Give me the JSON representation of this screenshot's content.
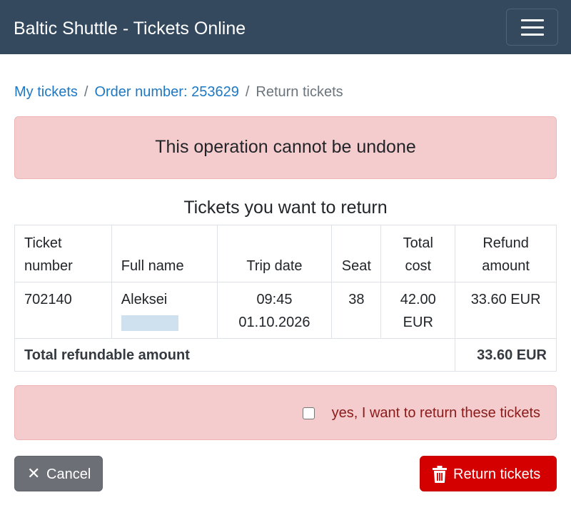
{
  "header": {
    "brand": "Baltic Shuttle - Tickets Online",
    "menu_icon": "hamburger-menu-icon"
  },
  "breadcrumb": {
    "items": [
      "My tickets",
      "Order number: 253629",
      "Return tickets"
    ],
    "separator": "/"
  },
  "alert": {
    "text": "This operation cannot be undone"
  },
  "section": {
    "title": "Tickets you want to return"
  },
  "table": {
    "headers": {
      "ticket_number": "Ticket number",
      "full_name": "Full name",
      "trip_date": "Trip date",
      "seat": "Seat",
      "total_cost": "Total cost",
      "refund_amount": "Refund amount"
    },
    "rows": [
      {
        "ticket_number": "702140",
        "full_name": "Aleksei",
        "trip_time": "09:45",
        "trip_date": "01.10.2026",
        "seat": "38",
        "total_cost": "42.00 EUR",
        "refund_amount": "33.60 EUR"
      }
    ],
    "footer": {
      "label": "Total refundable amount",
      "value": "33.60 EUR"
    }
  },
  "confirm": {
    "label": "yes, I want to return these tickets",
    "checked": false
  },
  "buttons": {
    "cancel_label": "Cancel",
    "cancel_icon": "close-icon",
    "return_label": "Return tickets",
    "return_icon": "trash-icon"
  },
  "colors": {
    "navbar": "#34495e",
    "danger_bg": "#f5cccd",
    "link": "#1f78c1",
    "return_button": "#d40000",
    "cancel_button": "#6c6f76"
  }
}
